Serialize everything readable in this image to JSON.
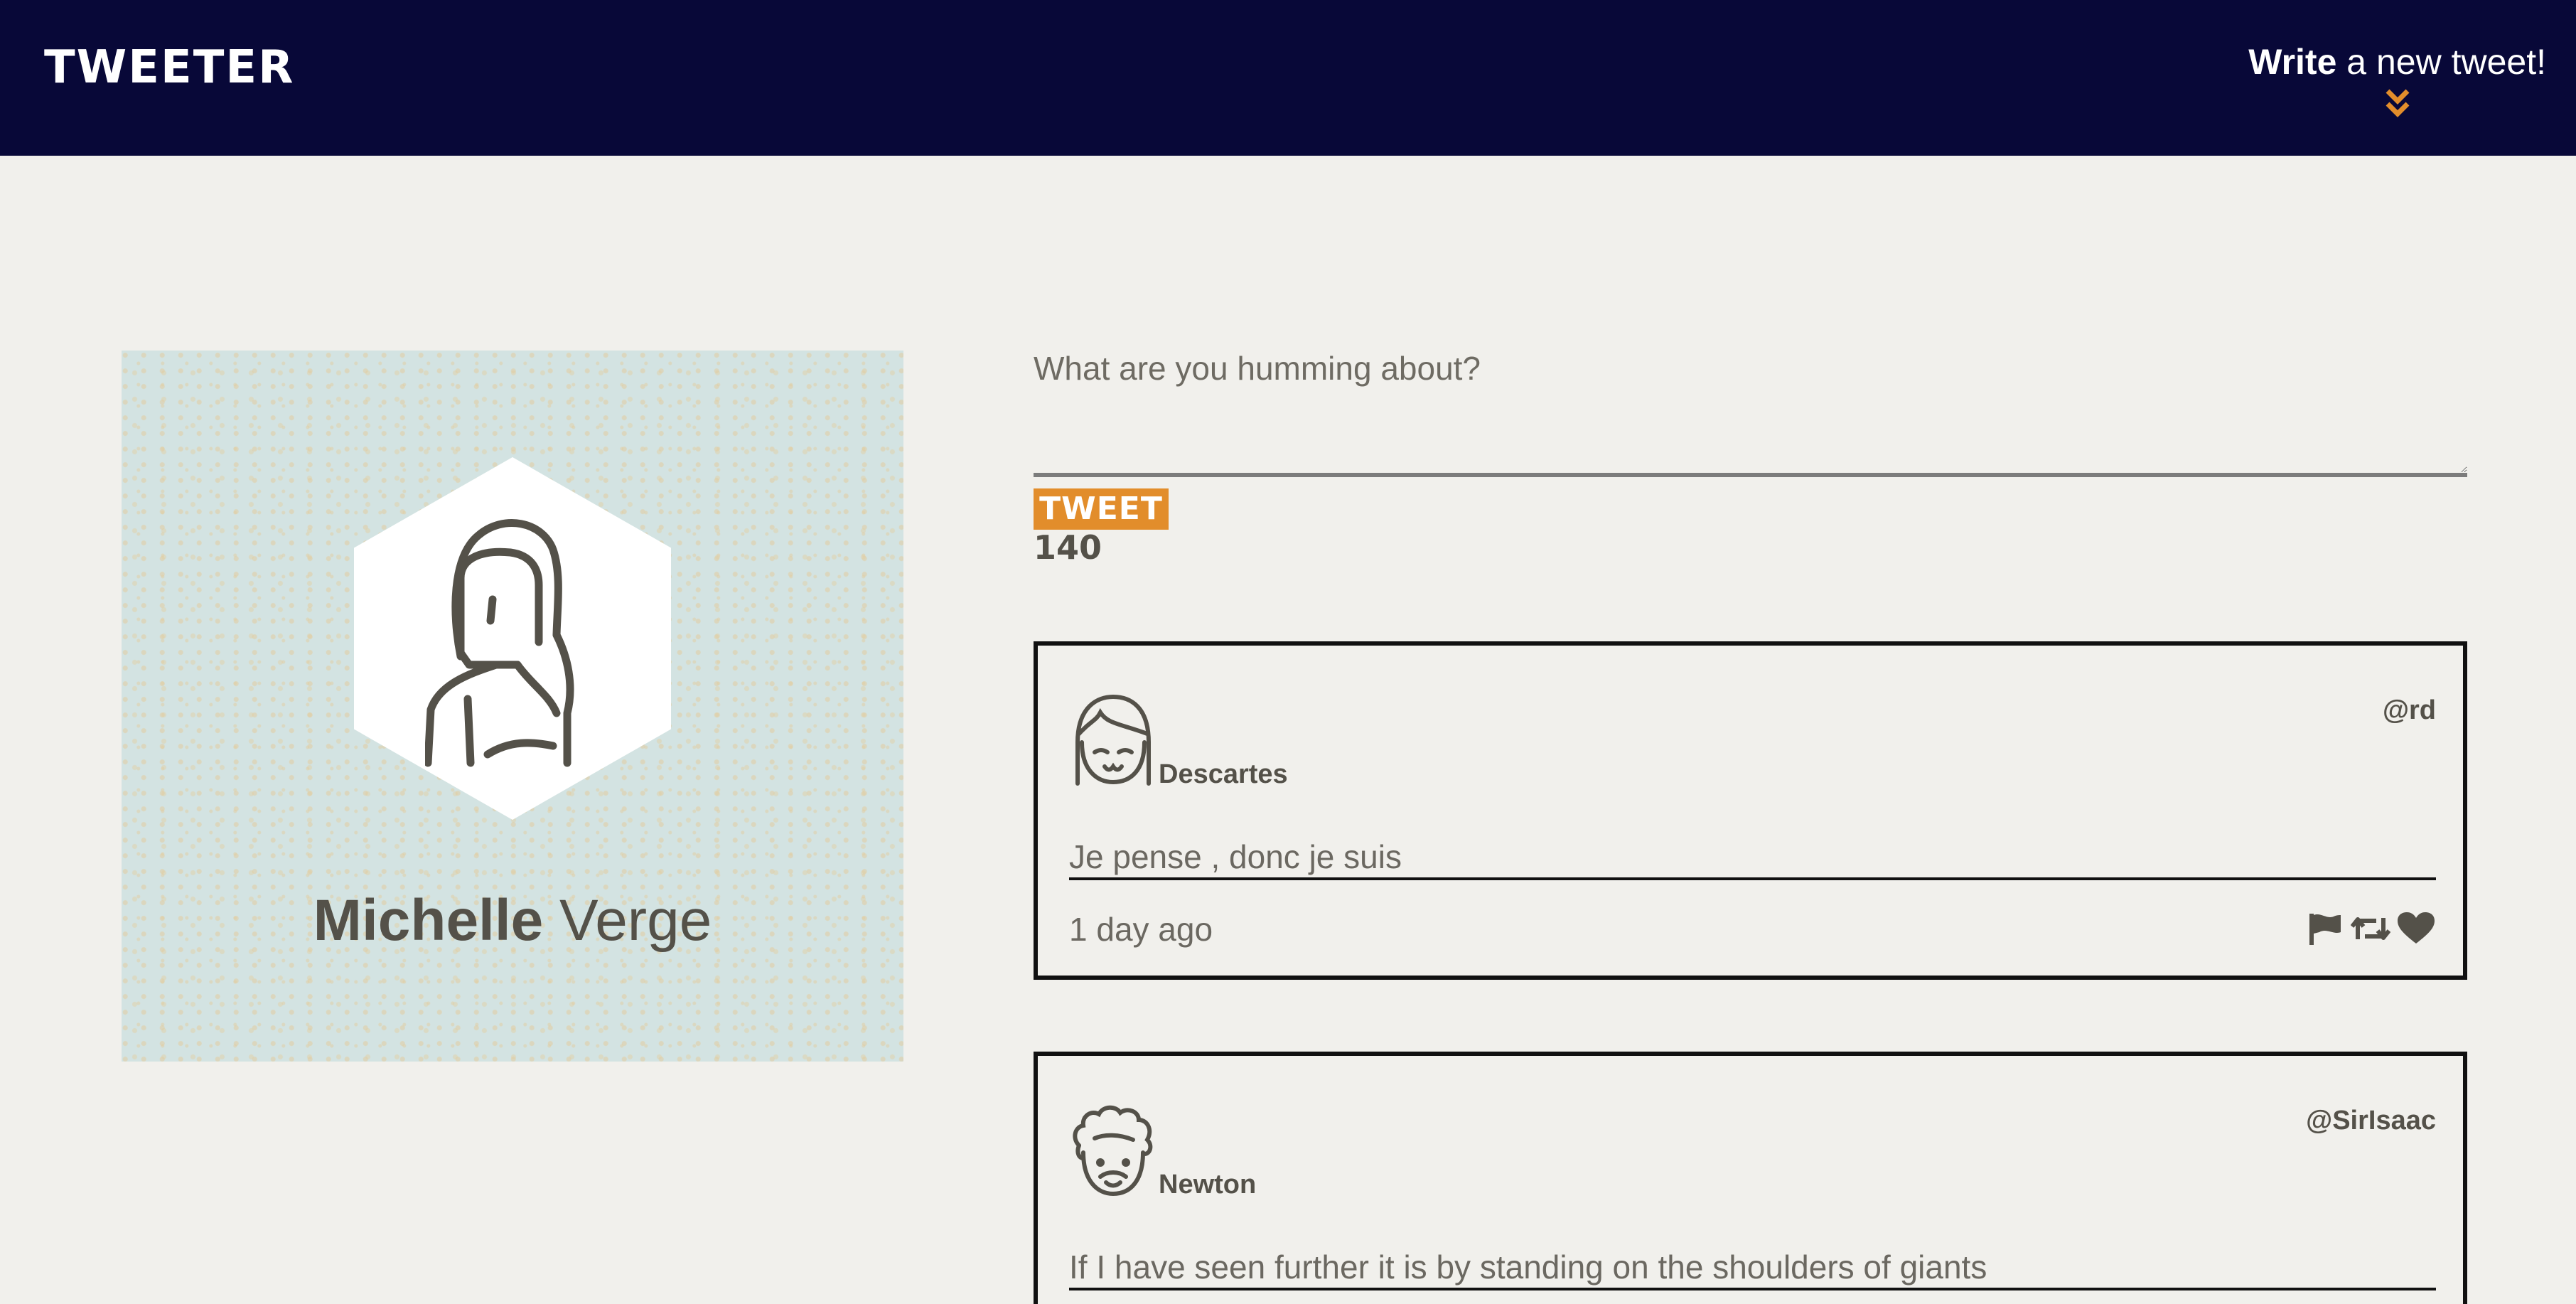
{
  "nav": {
    "logo": "TWEETER",
    "compose_bold": "Write",
    "compose_rest": " a new tweet!",
    "accent": "#e28d2b",
    "background": "#080838"
  },
  "profile": {
    "first_name": "Michelle",
    "last_name": "Verge",
    "avatar_icon": "woman-avatar-icon",
    "card_color": "#d3e3e2"
  },
  "composer": {
    "placeholder": "What are you humming about?",
    "value": "",
    "button_label": "TWEET",
    "counter": "140"
  },
  "tweets": [
    {
      "name": "Descartes",
      "handle": "@rd",
      "content": "Je pense , donc je suis",
      "time": "1 day ago",
      "avatar_icon": "girl-avatar-icon"
    },
    {
      "name": "Newton",
      "handle": "@SirIsaac",
      "content": "If I have seen further it is by standing on the shoulders of giants",
      "avatar_icon": "curly-hair-avatar-icon"
    }
  ],
  "actions": [
    "flag-icon",
    "retweet-icon",
    "heart-icon"
  ]
}
